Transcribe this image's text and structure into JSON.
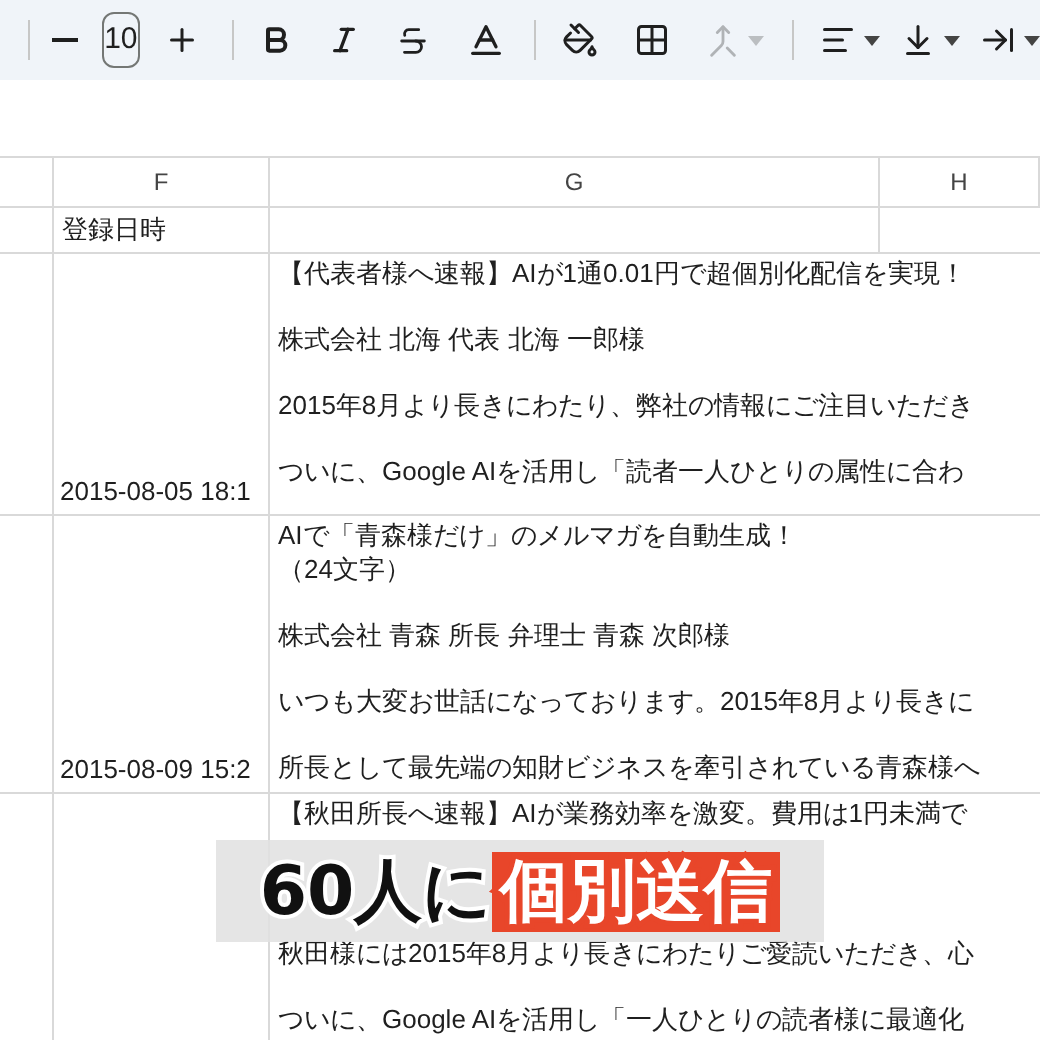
{
  "toolbar": {
    "font_size": "10",
    "merge_cells": {
      "disabled": true
    }
  },
  "columns": [
    "F",
    "G",
    "H"
  ],
  "header_row": {
    "column_f": "登録日時"
  },
  "rows": [
    {
      "registered_at": "2015-08-05 18:1",
      "paragraphs": [
        [
          "【代表者様へ速報】AIが1通0.01円で超個別化配信を実現！"
        ],
        [
          "株式会社 北海 代表 北海 一郎様"
        ],
        [
          "2015年8月より長きにわたり、弊社の情報にご注目いただき"
        ],
        [
          "ついに、Google AIを活用し「読者一人ひとりの属性に合わ"
        ]
      ]
    },
    {
      "registered_at": "2015-08-09 15:2",
      "paragraphs": [
        [
          "AIで「青森様だけ」のメルマガを自動生成！",
          "（24文字）"
        ],
        [
          "株式会社 青森 所長 弁理士 青森 次郎様"
        ],
        [
          "いつも大変お世話になっております。2015年8月より長きに"
        ],
        [
          "所長として最先端の知財ビジネスを牽引されている青森様へ"
        ]
      ]
    },
    {
      "paragraphs": [
        [
          "【秋田所長へ速報】AIが業務効率を激変。費用は1円未満で"
        ],
        [
          "秋田様には2015年8月より長きにわたりご愛読いただき、心"
        ],
        [
          "ついに、Google AIを活用し「一人ひとりの読者様に最適化"
        ]
      ]
    }
  ],
  "caption": {
    "lead": "60人に",
    "highlight": "個別送信"
  }
}
